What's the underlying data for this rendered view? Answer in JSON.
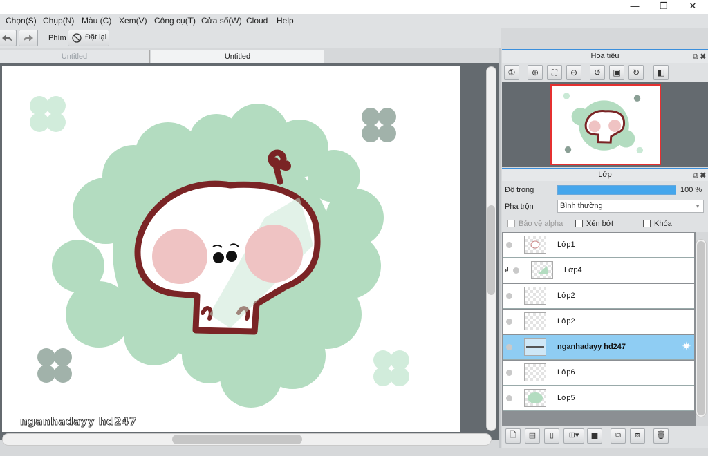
{
  "window": {
    "controls": {
      "minimize": "—",
      "maximize": "❐",
      "close": "✕"
    }
  },
  "menu": [
    "Chọn(S)",
    "Chụp(N)",
    "Màu (C)",
    "Xem(V)",
    "Công cụ(T)",
    "Cửa sổ(W)",
    "Cloud",
    "Help"
  ],
  "toolbar": {
    "keys_label": "Phím",
    "reset_label": "Đặt lại"
  },
  "tabs": [
    {
      "label": "Untitled",
      "active": false
    },
    {
      "label": "Untitled",
      "active": true
    }
  ],
  "canvas": {
    "watermark": "nganhadayy hd247"
  },
  "navigator": {
    "title": "Hoa tiêu"
  },
  "layers_panel": {
    "title": "Lớp",
    "opacity_label": "Độ trong",
    "opacity_value": "100 %",
    "opacity": 1.0,
    "blend_label": "Pha trộn",
    "blend_value": "Bình thường",
    "protect_alpha_label": "Bảo vệ alpha",
    "clip_label": "Xén bớt",
    "lock_label": "Khóa",
    "layers": [
      {
        "name": "Lớp1"
      },
      {
        "name": "Lớp4"
      },
      {
        "name": "Lớp2"
      },
      {
        "name": "Lớp2"
      },
      {
        "name": "nganhadayy hd247"
      },
      {
        "name": "Lớp6"
      },
      {
        "name": "Lớp5"
      }
    ]
  },
  "colors": {
    "accent": "#3b8fdc",
    "selected_layer": "#8fcdf3",
    "blob": "#b3dcc0",
    "outline": "#7a2425",
    "cheek": "#efc3c3"
  }
}
